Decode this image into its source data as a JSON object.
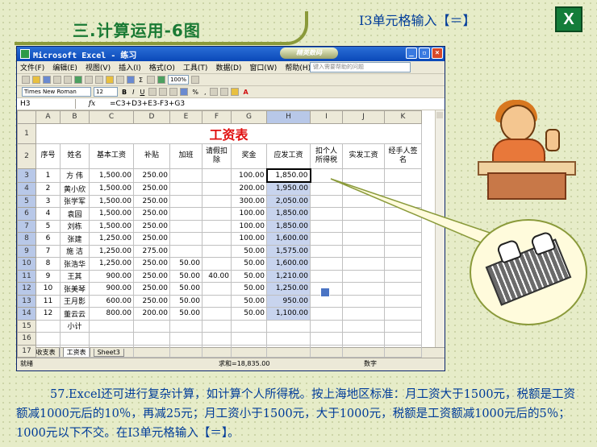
{
  "slide": {
    "title": "三.计算运用-6图",
    "instruction": "I3单元格输入【＝】",
    "logo_letter": "X",
    "body_text": "57.Excel还可进行复杂计算，如计算个人所得税。按上海地区标准：月工资大于1500元，税额是工资额减1000元后的10％，再减25元；月工资小于1500元，大于1000元，税额是工资额减1000元后的5％；1000元以下不交。在I3单元格输入【＝】。"
  },
  "excel": {
    "window_title": "Microsoft Excel - 练习",
    "badge": "精英数码",
    "menu": [
      "文件(F)",
      "编辑(E)",
      "视图(V)",
      "插入(I)",
      "格式(O)",
      "工具(T)",
      "数据(D)",
      "窗口(W)",
      "帮助(H)"
    ],
    "help_placeholder": "键入需要帮助的问题",
    "font_name": "Times New Roman",
    "font_size": "12",
    "zoom": "100%",
    "name_box": "H3",
    "fx": "fx",
    "formula": "=C3+D3+E3-F3+G3",
    "column_headers": [
      "A",
      "B",
      "C",
      "D",
      "E",
      "F",
      "G",
      "H",
      "I",
      "J",
      "K"
    ],
    "row_numbers": [
      "1",
      "2",
      "3",
      "4",
      "5",
      "6",
      "7",
      "8",
      "9",
      "10",
      "11",
      "12",
      "13",
      "14",
      "15",
      "16",
      "17"
    ],
    "sheet_title": "工资表",
    "table_headers": [
      "序号",
      "姓名",
      "基本工资",
      "补贴",
      "加班",
      "请假扣除",
      "奖金",
      "应发工资",
      "扣个人所得税",
      "实发工资",
      "经手人签名"
    ],
    "rows": [
      [
        "1",
        "方  伟",
        "1,500.00",
        "250.00",
        "",
        "",
        "100.00",
        "1,850.00"
      ],
      [
        "2",
        "黄小欣",
        "1,500.00",
        "250.00",
        "",
        "",
        "200.00",
        "1,950.00"
      ],
      [
        "3",
        "张学军",
        "1,500.00",
        "250.00",
        "",
        "",
        "300.00",
        "2,050.00"
      ],
      [
        "4",
        "袁园",
        "1,500.00",
        "250.00",
        "",
        "",
        "100.00",
        "1,850.00"
      ],
      [
        "5",
        "刘栋",
        "1,500.00",
        "250.00",
        "",
        "",
        "100.00",
        "1,850.00"
      ],
      [
        "6",
        "张建",
        "1,250.00",
        "250.00",
        "",
        "",
        "100.00",
        "1,600.00"
      ],
      [
        "7",
        "施  洁",
        "1,250.00",
        "275.00",
        "",
        "",
        "50.00",
        "1,575.00"
      ],
      [
        "8",
        "张浩华",
        "1,250.00",
        "250.00",
        "50.00",
        "",
        "50.00",
        "1,600.00"
      ],
      [
        "9",
        "王其",
        "900.00",
        "250.00",
        "50.00",
        "40.00",
        "50.00",
        "1,210.00"
      ],
      [
        "10",
        "张美琴",
        "900.00",
        "250.00",
        "50.00",
        "",
        "50.00",
        "1,250.00"
      ],
      [
        "11",
        "王月影",
        "600.00",
        "250.00",
        "50.00",
        "",
        "50.00",
        "950.00"
      ],
      [
        "12",
        "董云云",
        "800.00",
        "200.00",
        "50.00",
        "",
        "50.00",
        "1,100.00"
      ]
    ],
    "subtotal_label": "小计",
    "sheet_tabs": [
      "收支表",
      "工资表",
      "Sheet3"
    ],
    "status_ready": "就绪",
    "status_sum": "求和=18,835.00",
    "status_mode": "数字"
  }
}
